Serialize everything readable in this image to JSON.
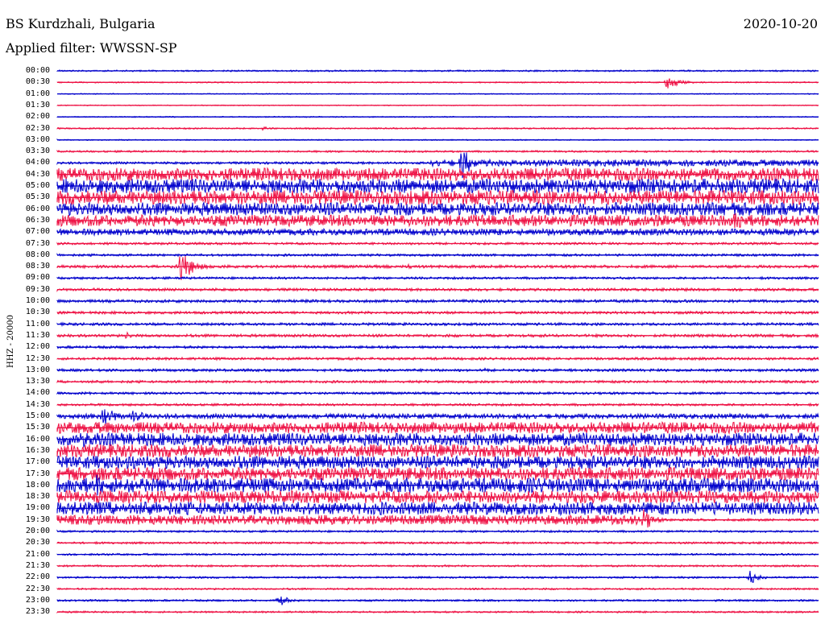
{
  "header": {
    "station": "BS Kurdzhali, Bulgaria",
    "date": "2020-10-20",
    "filter": "Applied filter: WWSSN-SP"
  },
  "channel_label": "HHZ - 20000",
  "colors": {
    "trace_a": "#0000cc",
    "trace_b": "#ee1144",
    "background": "#ffffff",
    "text": "#000000"
  },
  "rows": [
    {
      "time": "00:00",
      "noise": 1.0,
      "events": []
    },
    {
      "time": "00:30",
      "noise": 0.8,
      "events": [
        {
          "pos": 0.8,
          "amp": 9,
          "dur": 0.05
        }
      ]
    },
    {
      "time": "01:00",
      "noise": 0.6,
      "events": []
    },
    {
      "time": "01:30",
      "noise": 0.6,
      "events": []
    },
    {
      "time": "02:00",
      "noise": 0.7,
      "events": []
    },
    {
      "time": "02:30",
      "noise": 0.9,
      "events": [
        {
          "pos": 0.27,
          "amp": 3,
          "dur": 0.04
        }
      ]
    },
    {
      "time": "03:00",
      "noise": 0.7,
      "events": []
    },
    {
      "time": "03:30",
      "noise": 1.2,
      "events": []
    },
    {
      "time": "04:00",
      "noise": 1.5,
      "level_after": {
        "pos": 0.49,
        "noise": 4
      },
      "events": [
        {
          "pos": 0.53,
          "amp": 24,
          "dur": 0.04
        }
      ]
    },
    {
      "time": "04:30",
      "noise": 8,
      "events": []
    },
    {
      "time": "05:00",
      "noise": 9,
      "events": []
    },
    {
      "time": "05:30",
      "noise": 9,
      "events": []
    },
    {
      "time": "06:00",
      "noise": 8,
      "events": []
    },
    {
      "time": "06:30",
      "noise": 7,
      "events": [
        {
          "pos": 0.89,
          "amp": 15,
          "dur": 0.05
        }
      ]
    },
    {
      "time": "07:00",
      "noise": 4,
      "events": []
    },
    {
      "time": "07:30",
      "noise": 1.5,
      "events": []
    },
    {
      "time": "08:00",
      "noise": 1.5,
      "events": []
    },
    {
      "time": "08:30",
      "noise": 1.8,
      "events": [
        {
          "pos": 0.16,
          "amp": 25,
          "dur": 0.05
        },
        {
          "pos": 0.46,
          "amp": 4,
          "dur": 0.02
        }
      ]
    },
    {
      "time": "09:00",
      "noise": 1.5,
      "events": []
    },
    {
      "time": "09:30",
      "noise": 1.7,
      "events": []
    },
    {
      "time": "10:00",
      "noise": 1.8,
      "events": []
    },
    {
      "time": "10:30",
      "noise": 1.7,
      "events": []
    },
    {
      "time": "11:00",
      "noise": 1.7,
      "events": []
    },
    {
      "time": "11:30",
      "noise": 1.8,
      "events": [
        {
          "pos": 0.09,
          "amp": 5,
          "dur": 0.03
        }
      ]
    },
    {
      "time": "12:00",
      "noise": 1.6,
      "events": []
    },
    {
      "time": "12:30",
      "noise": 1.6,
      "events": []
    },
    {
      "time": "13:00",
      "noise": 1.7,
      "events": [
        {
          "pos": 0.56,
          "amp": 3,
          "dur": 0.02
        }
      ]
    },
    {
      "time": "13:30",
      "noise": 1.6,
      "events": []
    },
    {
      "time": "14:00",
      "noise": 1.5,
      "events": []
    },
    {
      "time": "14:30",
      "noise": 1.5,
      "events": []
    },
    {
      "time": "15:00",
      "noise": 3,
      "events": [
        {
          "pos": 0.06,
          "amp": 14,
          "dur": 0.06
        },
        {
          "pos": 0.1,
          "amp": 14,
          "dur": 0.03
        }
      ]
    },
    {
      "time": "15:30",
      "noise": 7,
      "events": []
    },
    {
      "time": "16:00",
      "noise": 8,
      "events": [
        {
          "pos": 0.03,
          "amp": 15,
          "dur": 0.05
        }
      ]
    },
    {
      "time": "16:30",
      "noise": 8,
      "events": []
    },
    {
      "time": "17:00",
      "noise": 8,
      "events": []
    },
    {
      "time": "17:30",
      "noise": 8,
      "events": []
    },
    {
      "time": "18:00",
      "noise": 9,
      "events": [
        {
          "pos": 0.05,
          "amp": 14,
          "dur": 0.12
        }
      ]
    },
    {
      "time": "18:30",
      "noise": 8,
      "events": []
    },
    {
      "time": "19:00",
      "noise": 8,
      "events": []
    },
    {
      "time": "19:30",
      "noise": 6,
      "level_after": {
        "pos": 0.77,
        "noise": 1.5
      },
      "events": [
        {
          "pos": 0.77,
          "amp": 15,
          "dur": 0.04
        }
      ]
    },
    {
      "time": "20:00",
      "noise": 1.3,
      "events": []
    },
    {
      "time": "20:30",
      "noise": 1.3,
      "events": []
    },
    {
      "time": "21:00",
      "noise": 1.2,
      "events": []
    },
    {
      "time": "21:30",
      "noise": 1.2,
      "events": []
    },
    {
      "time": "22:00",
      "noise": 1.2,
      "events": [
        {
          "pos": 0.91,
          "amp": 9,
          "dur": 0.04
        }
      ]
    },
    {
      "time": "22:30",
      "noise": 1.1,
      "events": []
    },
    {
      "time": "23:00",
      "noise": 1.2,
      "events": [
        {
          "pos": 0.29,
          "amp": 8,
          "dur": 0.04
        },
        {
          "pos": 0.58,
          "amp": 2,
          "dur": 0.02
        }
      ]
    },
    {
      "time": "23:30",
      "noise": 1.1,
      "events": []
    }
  ]
}
